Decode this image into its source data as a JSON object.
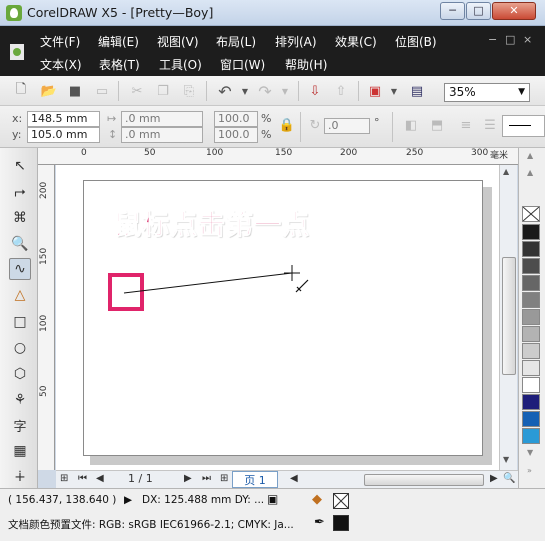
{
  "window": {
    "title": "CorelDRAW X5 - [Pretty—Boy]",
    "minimize": "─",
    "maximize": "□",
    "close": "✕"
  },
  "menu": {
    "row1": [
      "文件(F)",
      "编辑(E)",
      "视图(V)",
      "布局(L)",
      "排列(A)",
      "效果(C)",
      "位图(B)"
    ],
    "row2": [
      "文本(X)",
      "表格(T)",
      "工具(O)",
      "窗口(W)",
      "帮助(H)"
    ],
    "doc_controls": [
      "−",
      "□",
      "×"
    ]
  },
  "standard_toolbar": {
    "zoom": "35%",
    "icons": [
      "new-icon",
      "open-icon",
      "save-icon",
      "print-icon",
      "cut-icon",
      "copy-icon",
      "paste-icon",
      "undo-icon",
      "redo-icon",
      "import-icon",
      "export-icon",
      "app-launcher-icon",
      "welcome-icon"
    ]
  },
  "property_bar": {
    "x_label": "x:",
    "x_value": "148.5 mm",
    "y_label": "y:",
    "y_value": "105.0 mm",
    "width_value": ".0 mm",
    "height_value": ".0 mm",
    "scale_x": "100.0",
    "scale_y": "100.0",
    "percent": "%",
    "rotation": ".0",
    "degree": "°"
  },
  "ruler": {
    "unit": "毫米",
    "top_ticks": [
      "0",
      "50",
      "100",
      "150",
      "200",
      "250",
      "300"
    ],
    "left_ticks": [
      "200",
      "150",
      "100",
      "50"
    ]
  },
  "canvas": {
    "caption": "鼠标点击第一点",
    "highlight_color": "#e0246a",
    "caption_color": "#d8336e"
  },
  "page_nav": {
    "count": "1 / 1",
    "current_page": "页 1"
  },
  "palette": {
    "colors": [
      "#1a1a1a",
      "#333333",
      "#4d4d4d",
      "#666666",
      "#808080",
      "#999999",
      "#b3b3b3",
      "#cccccc",
      "#e6e6e6",
      "#ffffff",
      "#1e1e7a",
      "#1460b4",
      "#2a9ad6"
    ]
  },
  "status": {
    "coords": "( 156.437, 138.640 )",
    "distance": "DX: 125.488 mm DY: ...",
    "color_profile": "文档颜色预置文件: RGB: sRGB IEC61966-2.1; CMYK: Ja..."
  }
}
